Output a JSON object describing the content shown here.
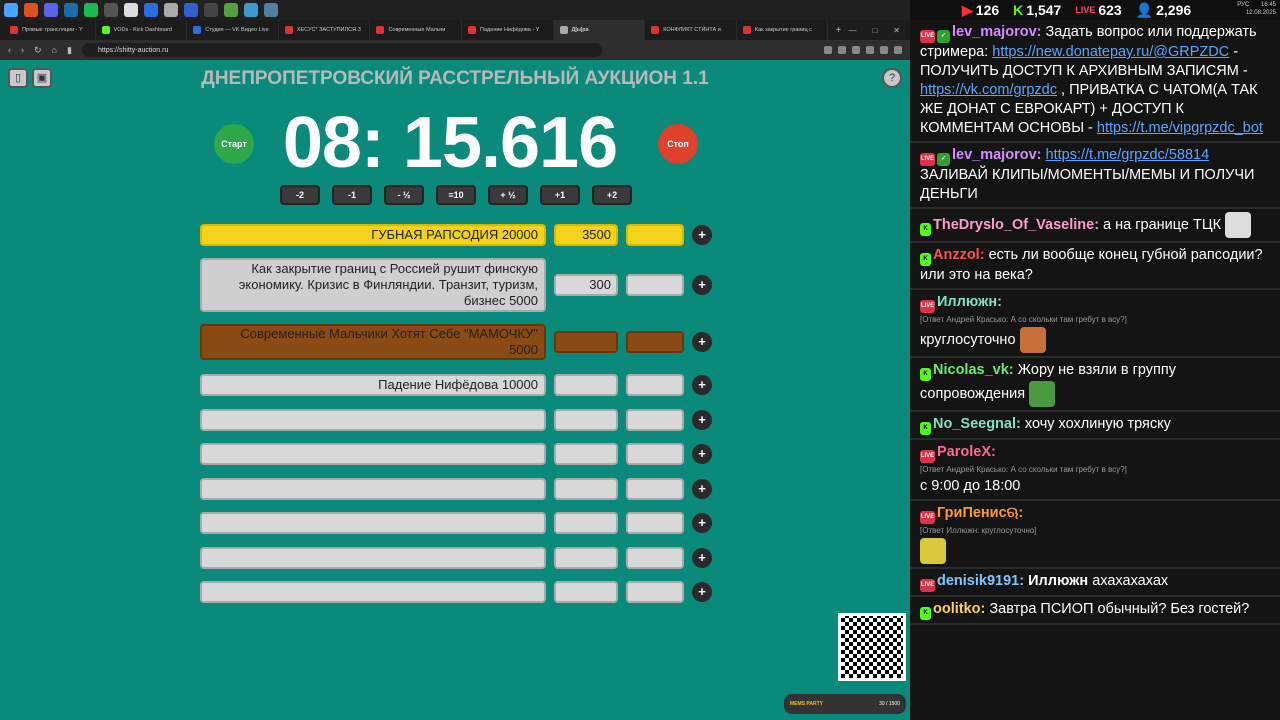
{
  "browser": {
    "tabs": [
      {
        "label": "Прямые трансляции - Y",
        "color": "#e03030"
      },
      {
        "label": "VODs - Kick Dashboard",
        "color": "#53fc18"
      },
      {
        "label": "Студия — VK Видео Live",
        "color": "#2a6ee0"
      },
      {
        "label": "ХЕСУС* ЗАСТУПИЛСЯ З",
        "color": "#e03030"
      },
      {
        "label": "Современные Мальчи",
        "color": "#e03030"
      },
      {
        "label": "Падение Нифёдова - Y",
        "color": "#e03030"
      },
      {
        "label": "Д[ы]ра",
        "color": "#aaaaaa"
      },
      {
        "label": "КОНФЛИКТ СТИНТА и",
        "color": "#e03030"
      },
      {
        "label": "Как закрытие границ с",
        "color": "#e03030"
      }
    ],
    "active_tab": 6,
    "url": "https://shitty-auction.ru"
  },
  "auction": {
    "title": "ДНЕПРОПЕТРОВСКИЙ РАССТРЕЛЬНЫЙ АУКЦИОН 1.1",
    "timer": "08: 15.616",
    "start_label": "Старт",
    "stop_label": "Стоп",
    "adjust": [
      "-2",
      "-1",
      "- ½",
      "≡10",
      "+ ½",
      "+1",
      "+2"
    ],
    "lots": [
      {
        "name": "ГУБНАЯ РАПСОДИЯ 20000",
        "amount": "3500",
        "style": "yellow"
      },
      {
        "name": "Как закрытие границ с Россией рушит финскую экономику. Кризис в Финляндии. Транзит, туризм, бизнес 5000",
        "amount": "300",
        "style": "gray"
      },
      {
        "name": "Современные Мальчики Хотят Себе \"МАМОЧКУ\" 5000",
        "amount": "",
        "style": "brown"
      },
      {
        "name": "Падение Нифёдова 10000",
        "amount": "",
        "style": "plain"
      },
      {
        "name": "",
        "amount": "",
        "style": "plain"
      },
      {
        "name": "",
        "amount": "",
        "style": "plain"
      },
      {
        "name": "",
        "amount": "",
        "style": "plain"
      },
      {
        "name": "",
        "amount": "",
        "style": "plain"
      },
      {
        "name": "",
        "amount": "",
        "style": "plain"
      },
      {
        "name": "",
        "amount": "",
        "style": "plain"
      }
    ],
    "donate_widget": {
      "label": "MEMS PARTY",
      "progress": "30 / 1500"
    }
  },
  "chat": {
    "stats": [
      "126",
      "1,547",
      "623",
      "2,296"
    ],
    "clock": {
      "time": "16:45",
      "date": "12.08.2025",
      "lang": "РУС"
    },
    "messages": [
      {
        "badges": [
          "live",
          "check"
        ],
        "user": "lev_majorov",
        "color": "#d58cff",
        "parts": [
          {
            "t": " Задать вопрос или поддержать стримера: "
          },
          {
            "t": "https://new.donatepay.ru/@GRPZDC",
            "link": true
          },
          {
            "t": " - ПОЛУЧИТЬ ДОСТУП К АРХИВНЫМ ЗАПИСЯМ - "
          },
          {
            "t": "https://vk.com/grpzdc",
            "link": true
          },
          {
            "t": " , ПРИВАТКА С ЧАТОМ(А ТАК ЖЕ ДОНАТ С ЕВРОКАРТ) + ДОСТУП К КОММЕНТАМ ОСНОВЫ - "
          },
          {
            "t": "https://t.me/vipgrpzdc_bot",
            "link": true
          }
        ]
      },
      {
        "badges": [
          "live",
          "check"
        ],
        "user": "lev_majorov",
        "color": "#d58cff",
        "parts": [
          {
            "t": " "
          },
          {
            "t": "https://t.me/grpzdc/58814",
            "link": true
          },
          {
            "t": " ЗАЛИВАЙ КЛИПЫ/МОМЕНТЫ/МЕМЫ И ПОЛУЧИ ДЕНЬГИ"
          }
        ]
      },
      {
        "badges": [
          "kick"
        ],
        "user": "TheDryslo_Of_Vaseline",
        "color": "#ff9ad0",
        "parts": [
          {
            "t": " а на границе ТЦК "
          }
        ],
        "emote": "#dddddd"
      },
      {
        "badges": [
          "kick"
        ],
        "user": "Anzzol",
        "color": "#ff5050",
        "parts": [
          {
            "t": " есть ли вообще конец губной рапсодии? или это на века?"
          }
        ]
      },
      {
        "badges": [
          "live"
        ],
        "user": "Иллюжн",
        "color": "#7fe3c3",
        "reply": "[Ответ Андрей Красько: А со скольки там гребут в всу?]",
        "parts": [
          {
            "t": "круглосуточно "
          }
        ],
        "emote": "#c8703a",
        "newline": true
      },
      {
        "badges": [
          "kick"
        ],
        "user": "Nicolas_vk",
        "color": "#6fe86f",
        "parts": [
          {
            "t": " Жору не взяли в группу сопровождения "
          }
        ],
        "emote": "#4a9a40"
      },
      {
        "badges": [
          "kick"
        ],
        "user": "No_Seegnal",
        "color": "#7fe3c3",
        "parts": [
          {
            "t": " хочу хохлиную тряску"
          }
        ]
      },
      {
        "badges": [
          "live"
        ],
        "user": "ParoleX",
        "color": "#ff6b8a",
        "reply": "[Ответ Андрей Красько: А со скольки там гребут в всу?]",
        "parts": [
          {
            "t": "с 9:00 до 18:00"
          }
        ],
        "newline": true
      },
      {
        "badges": [
          "live"
        ],
        "user": "ГриПенисଋ",
        "color": "#ff9a3c",
        "reply": "[Ответ Иллюжн: круглосуточно]",
        "parts": [
          {
            "t": ""
          }
        ],
        "emote": "#d8c83a",
        "newline": true
      },
      {
        "badges": [
          "live"
        ],
        "user": "denisik9191",
        "color": "#7fc7ff",
        "parts": [
          {
            "t": " "
          },
          {
            "t": "Иллюжн",
            "bold": true
          },
          {
            "t": " ахахахахах"
          }
        ]
      },
      {
        "badges": [
          "kick"
        ],
        "user": "oolitko",
        "color": "#ffd060",
        "parts": [
          {
            "t": " Завтра ПСИОП обычный? Без гостей?"
          }
        ]
      }
    ]
  }
}
